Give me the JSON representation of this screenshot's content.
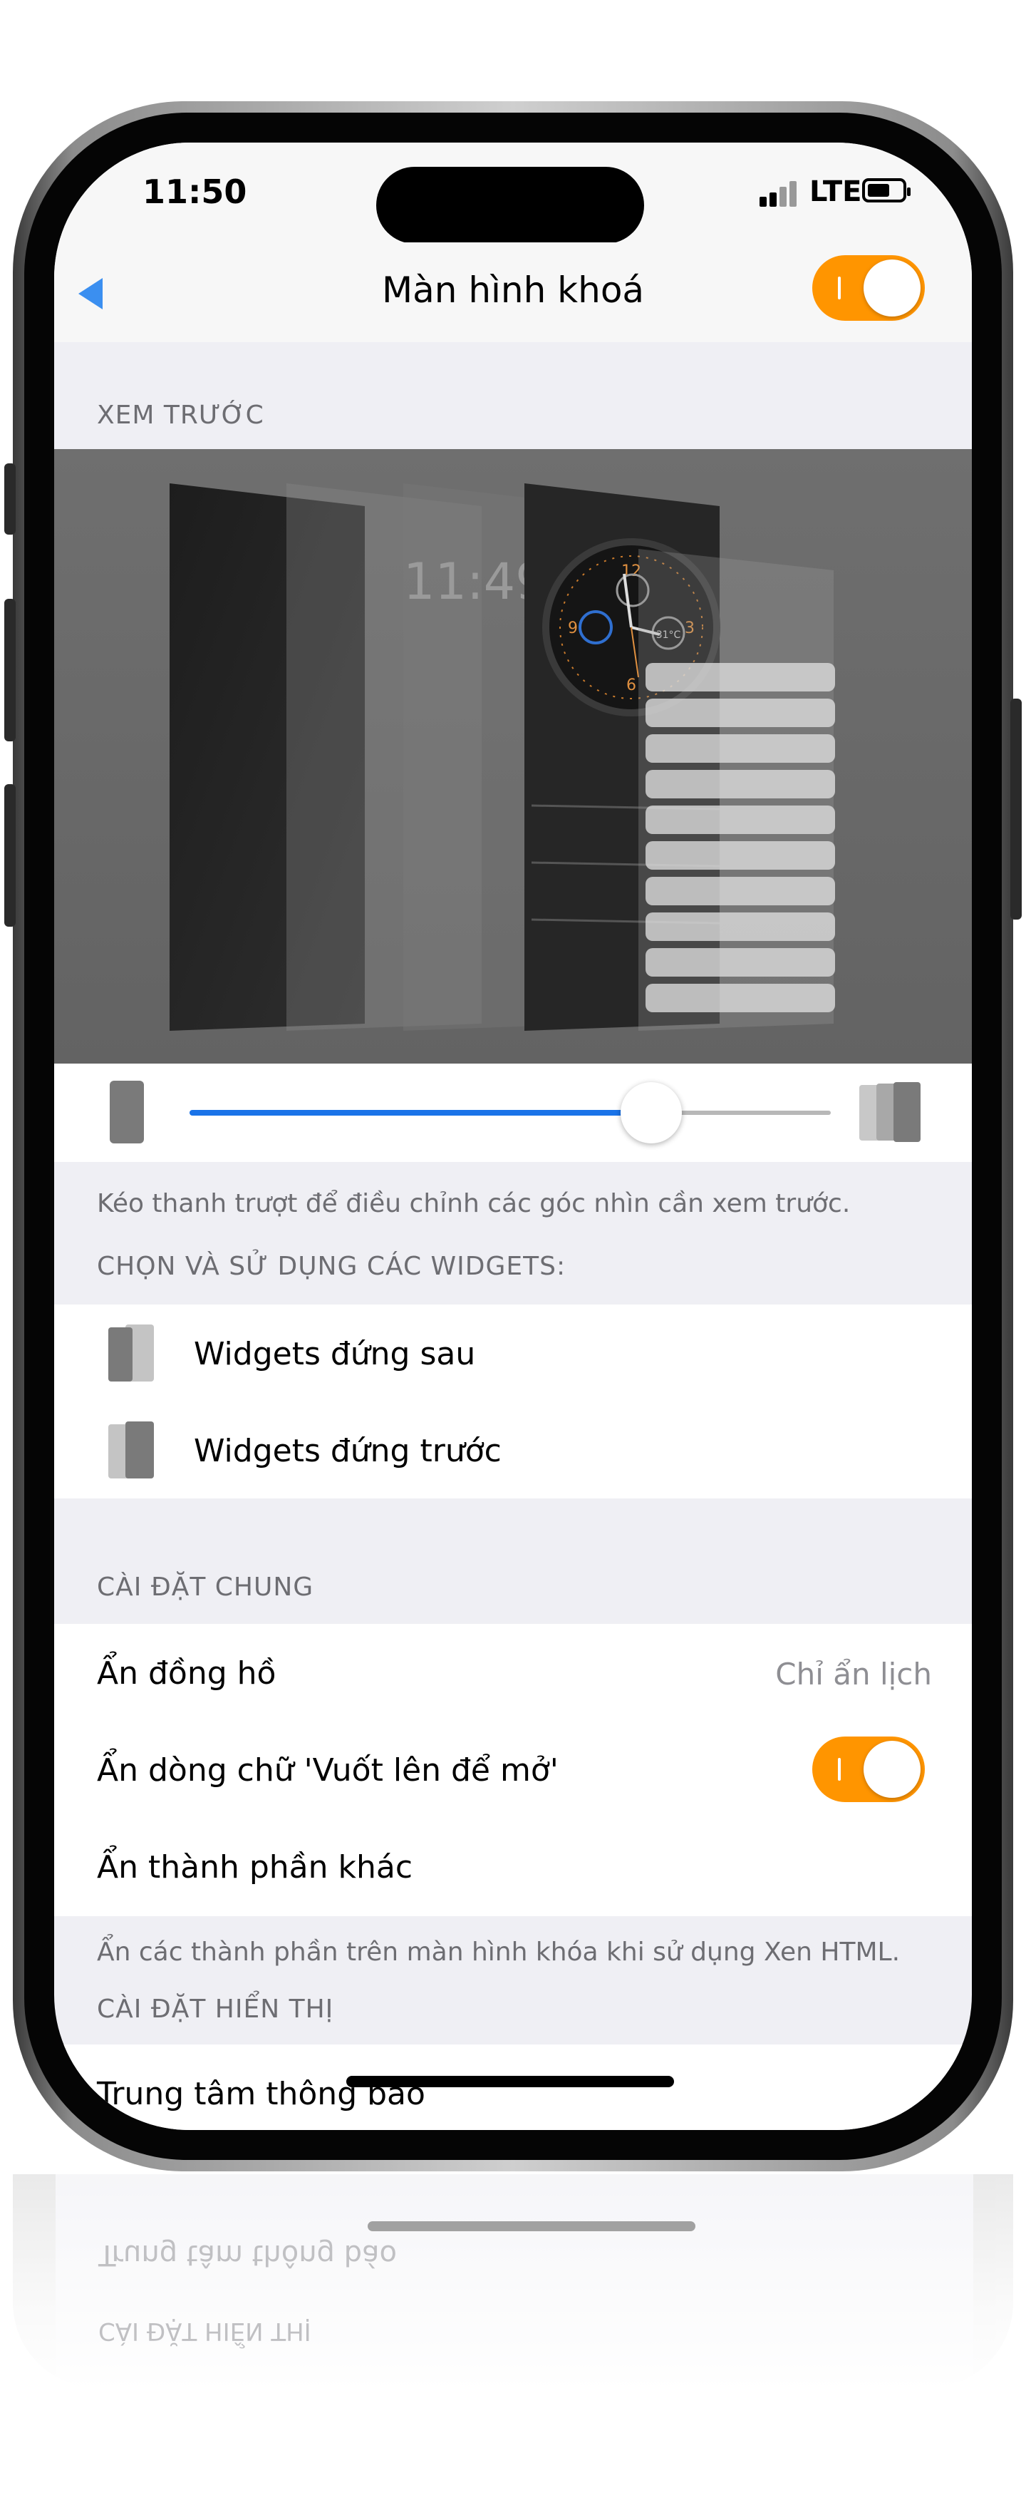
{
  "status_bar": {
    "time": "11:50",
    "network": "LTE"
  },
  "nav": {
    "title": "Màn hình khoá",
    "master_toggle_on": true
  },
  "preview_section": {
    "header": "XEM TRƯỚC",
    "clock_text": "11:49",
    "watch_numbers": [
      "12",
      "3",
      "6",
      "9"
    ],
    "watch_temp": "31°C",
    "slider_value": 0.72,
    "hint": "Kéo thanh trượt để điều chỉnh các góc nhìn cần xem trước."
  },
  "widgets_section": {
    "header": "CHỌN VÀ SỬ DỤNG CÁC WIDGETS:",
    "items": [
      {
        "label": "Widgets đứng sau",
        "icon": "stack-back-icon"
      },
      {
        "label": "Widgets đứng trước",
        "icon": "stack-front-icon"
      }
    ]
  },
  "general_section": {
    "header": "CÀI ĐẶT CHUNG",
    "rows": [
      {
        "label": "Ẩn đồng hồ",
        "value": "Chỉ ẩn lịch"
      },
      {
        "label": "Ẩn dòng chữ 'Vuốt lên để mở'",
        "toggle_on": true
      },
      {
        "label": "Ẩn thành phần khác"
      }
    ],
    "footer": "Ẩn các thành phần trên màn hình khóa khi sử dụng Xen HTML."
  },
  "display_section": {
    "header": "CÀI ĐẶT HIỂN THỊ",
    "rows": [
      {
        "label": "Trung tâm thông báo"
      }
    ]
  },
  "colors": {
    "accent": "#ff9500",
    "slider": "#1a73e8",
    "back_arrow": "#3b8ff0"
  }
}
